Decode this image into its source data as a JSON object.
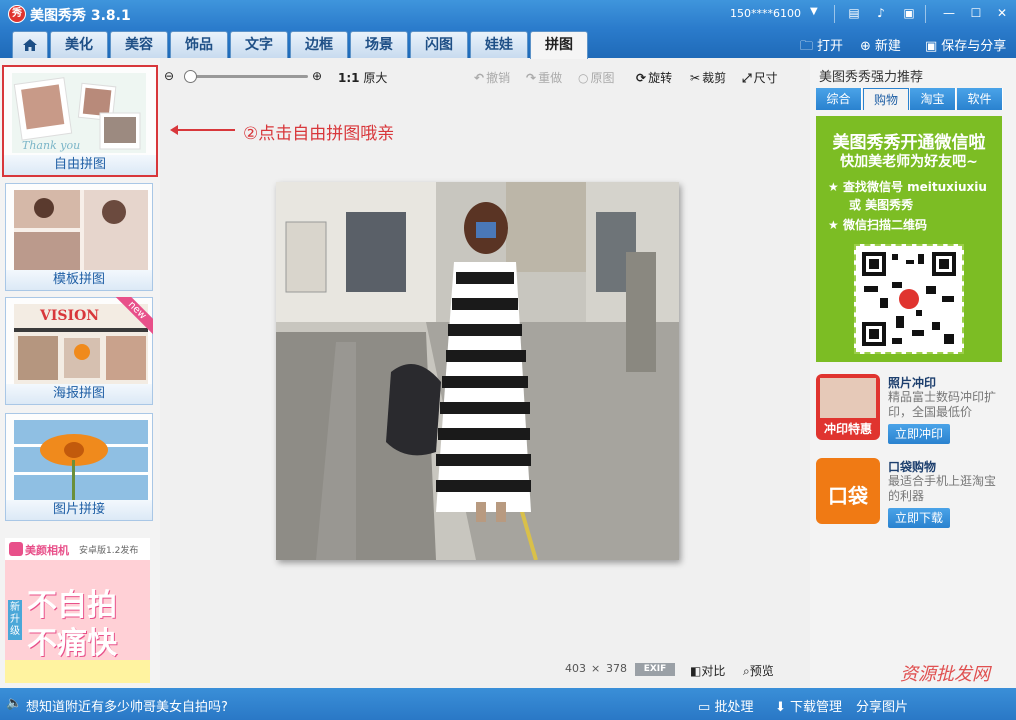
{
  "window": {
    "title": "美图秀秀 3.8.1",
    "logo_text": "秀",
    "account": "150****6100"
  },
  "tabs": {
    "home_icon": "home-icon",
    "items": [
      "美化",
      "美容",
      "饰品",
      "文字",
      "边框",
      "场景",
      "闪图",
      "娃娃",
      "拼图"
    ],
    "active": "拼图"
  },
  "top_actions": {
    "open": "打开",
    "new": "新建",
    "save_share": "保存与分享"
  },
  "toolbar": {
    "zoom_ratio": "1:1",
    "original_size": "原大",
    "undo": "撤销",
    "redo": "重做",
    "original": "原图",
    "rotate": "旋转",
    "crop": "裁剪",
    "resize": "尺寸"
  },
  "left_panel": {
    "templates": [
      {
        "label": "自由拼图",
        "selected": true
      },
      {
        "label": "模板拼图",
        "selected": false
      },
      {
        "label": "海报拼图",
        "selected": false
      },
      {
        "label": "图片拼接",
        "selected": false
      }
    ],
    "poster_badge": "new",
    "poster_thumb_text": "VISION",
    "free_thumb_text": "Thank you",
    "ad": {
      "brand": "美颜相机",
      "version": "安卓版1.2发布",
      "tag": "新升级",
      "line1": "不自拍",
      "line2": "不痛快"
    }
  },
  "annotation": {
    "text": "②点击自由拼图哦亲"
  },
  "image": {
    "width": "403",
    "times": "×",
    "height": "378",
    "exif": "EXIF",
    "compare": "对比",
    "preview": "预览"
  },
  "right_panel": {
    "title": "美图秀秀强力推荐",
    "tabs": [
      "综合",
      "购物",
      "淘宝",
      "软件"
    ],
    "active_tab": "购物",
    "wechat": {
      "headline": "美图秀秀开通微信啦",
      "subline": "快加美老师为好友吧~",
      "item1": "查找微信号 meituxiuxiu",
      "item1b": "或  美图秀秀",
      "item2": "微信扫描二维码"
    },
    "promos": [
      {
        "title": "照片冲印",
        "desc": "精品富士数码冲印扩印，全国最低价",
        "button": "立即冲印",
        "icon_text": "冲印特惠"
      },
      {
        "title": "口袋购物",
        "desc": "最适合手机上逛淘宝的利器",
        "button": "立即下载",
        "icon_text": "口袋"
      }
    ]
  },
  "statusbar": {
    "tip": "想知道附近有多少帅哥美女自拍吗?",
    "batch": "批处理",
    "download": "下载管理",
    "share": "分享图片"
  },
  "watermark": "资源批发网",
  "colors": {
    "brand_blue": "#2b7ccc",
    "accent_red": "#d8373b",
    "wechat_green": "#7cbd24"
  }
}
